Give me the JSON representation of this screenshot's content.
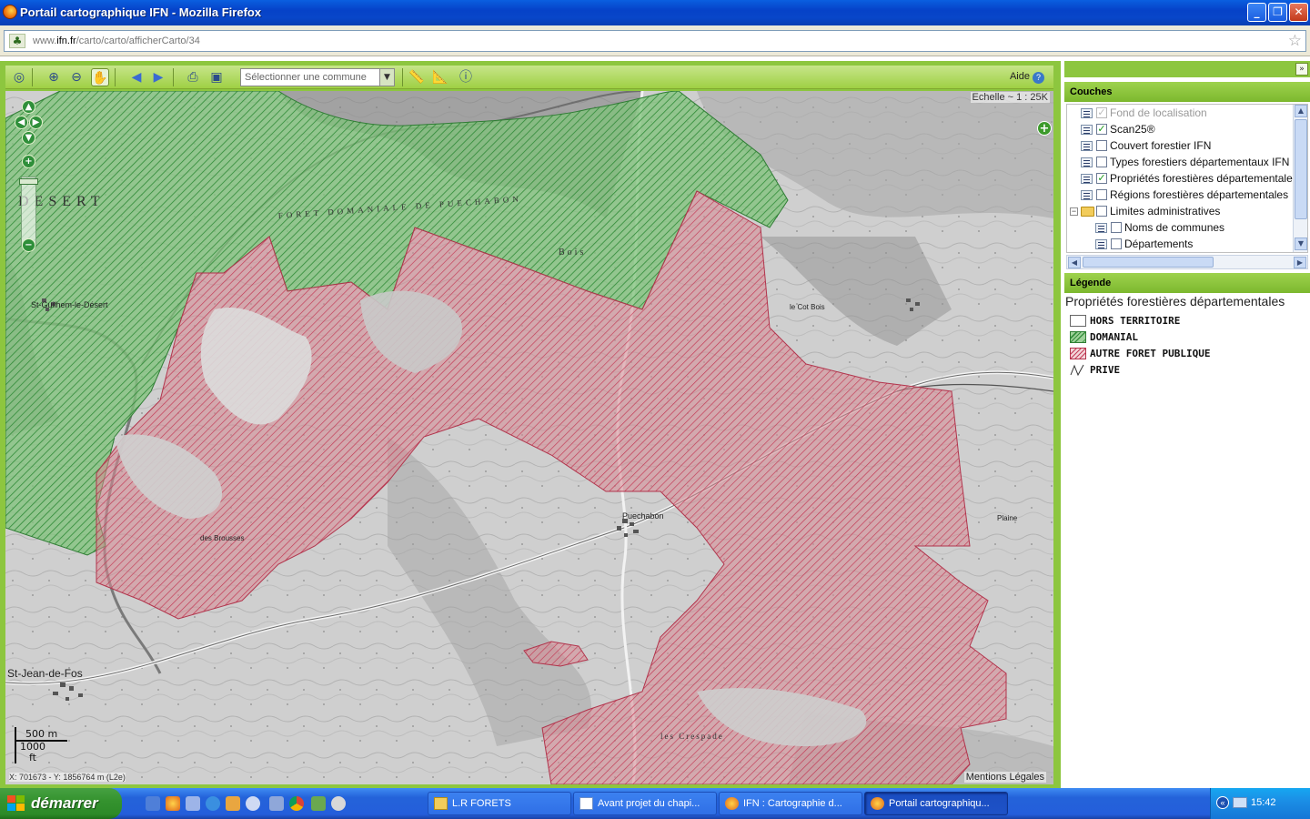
{
  "window": {
    "title": "Portail cartographique IFN - Mozilla Firefox",
    "minimize": "_",
    "maximize": "❐",
    "close": "✕"
  },
  "address": {
    "prefix": "www.",
    "domain": "ifn.fr",
    "path": "/carto/carto/afficherCarto/34"
  },
  "toolbar": {
    "commune_placeholder": "Sélectionner une commune",
    "help_label": "Aide",
    "help_icon": "?"
  },
  "map": {
    "scale": "Echelle ~ 1 : 25K",
    "scalebar_metric": "500 m",
    "scalebar_imperial": "1000 ft",
    "coordinates": "X: 701673 - Y: 1856764 m (L2e)",
    "legal": "Mentions Légales",
    "places": {
      "desert": "DESERT",
      "foret_domaniale": "FORET DOMANIALE DE PUECHABON",
      "saint_guilhem": "St-Guilhem-le-Désert",
      "saint_jean": "St-Jean-de-Fos",
      "puechabon": "Puechabon",
      "bois": "Bois",
      "cote_bois": "le Cot Bois",
      "bois_brousses": "des Brousses",
      "crespade": "les Crespade",
      "plaine": "Plaine"
    },
    "colors": {
      "domanial": "#5cb85a",
      "autre_foret_publique": "#d9405a",
      "terrain": "#c8c8c8"
    }
  },
  "panel": {
    "couches_title": "Couches",
    "layers": [
      {
        "label": "Fond de localisation",
        "checked": true,
        "disabled": true
      },
      {
        "label": "Scan25®",
        "checked": true,
        "disabled": false
      },
      {
        "label": "Couvert forestier IFN",
        "checked": false,
        "disabled": false
      },
      {
        "label": "Types forestiers départementaux IFN",
        "checked": false,
        "disabled": false
      },
      {
        "label": "Propriétés forestières départementales",
        "checked": true,
        "disabled": false
      },
      {
        "label": "Régions forestières départementales",
        "checked": false,
        "disabled": false
      },
      {
        "label": "Limites administratives",
        "checked": false,
        "disabled": false,
        "folder": true
      },
      {
        "label": "Noms de communes",
        "checked": false,
        "disabled": false
      },
      {
        "label": "Départements",
        "checked": false,
        "disabled": false
      }
    ],
    "legende_title": "Légende",
    "legend_heading": "Propriétés forestières départementales",
    "legend_items": [
      {
        "label": "HORS TERRITOIRE",
        "swatch": "none"
      },
      {
        "label": "DOMANIAL",
        "swatch": "green-hatch"
      },
      {
        "label": "AUTRE FORET PUBLIQUE",
        "swatch": "red-hatch"
      },
      {
        "label": "PRIVE",
        "swatch": "line"
      }
    ]
  },
  "taskbar": {
    "start_label": "démarrer",
    "tasks": [
      {
        "label": "L.R FORETS",
        "icon": "folder-icon"
      },
      {
        "label": "Avant projet du chapi...",
        "icon": "document-icon"
      },
      {
        "label": "IFN : Cartographie d...",
        "icon": "firefox-icon"
      },
      {
        "label": "Portail cartographiqu...",
        "icon": "firefox-icon",
        "active": true
      }
    ],
    "language": "FR",
    "clock": "15:42"
  }
}
